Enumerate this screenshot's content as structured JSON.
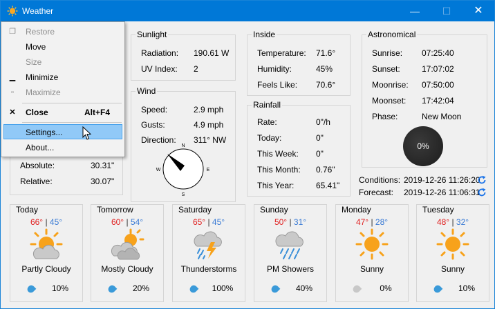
{
  "window": {
    "title": "Weather",
    "min_glyph": "—",
    "max_glyph": "☐",
    "close_glyph": "✕"
  },
  "sunlight": {
    "legend": "Sunlight",
    "radiation_label": "Radiation:",
    "radiation_value": "190.61 W",
    "uv_label": "UV Index:",
    "uv_value": "2"
  },
  "wind": {
    "legend": "Wind",
    "speed_label": "Speed:",
    "speed_value": "2.9 mph",
    "gusts_label": "Gusts:",
    "gusts_value": "4.9 mph",
    "direction_label": "Direction:",
    "direction_value": "311° NW",
    "compass": {
      "n": "N",
      "e": "E",
      "s": "S",
      "w": "W"
    }
  },
  "pressure": {
    "absolute_label": "Absolute:",
    "absolute_value": "30.31\"",
    "relative_label": "Relative:",
    "relative_value": "30.07\""
  },
  "inside": {
    "legend": "Inside",
    "temperature_label": "Temperature:",
    "temperature_value": "71.6°",
    "humidity_label": "Humidity:",
    "humidity_value": "45%",
    "feels_label": "Feels Like:",
    "feels_value": "70.6°"
  },
  "rainfall": {
    "legend": "Rainfall",
    "rate_label": "Rate:",
    "rate_value": "0\"/h",
    "today_label": "Today:",
    "today_value": "0\"",
    "week_label": "This Week:",
    "week_value": "0\"",
    "month_label": "This Month:",
    "month_value": "0.76\"",
    "year_label": "This Year:",
    "year_value": "65.41\""
  },
  "astronomical": {
    "legend": "Astronomical",
    "sunrise_label": "Sunrise:",
    "sunrise_value": "07:25:40",
    "sunset_label": "Sunset:",
    "sunset_value": "17:07:02",
    "moonrise_label": "Moonrise:",
    "moonrise_value": "07:50:00",
    "moonset_label": "Moonset:",
    "moonset_value": "17:42:04",
    "phase_label": "Phase:",
    "phase_value": "New Moon",
    "moon_pct": "0%"
  },
  "updates": {
    "conditions_label": "Conditions:",
    "conditions_value": "2019-12-26 11:26:20",
    "forecast_label": "Forecast:",
    "forecast_value": "2019-12-26 11:06:31"
  },
  "forecast": [
    {
      "day": "Today",
      "hi": "66°",
      "sep": "|",
      "lo": "45°",
      "cond": "Partly Cloudy",
      "precip": "10%",
      "icon": "partly-cloudy"
    },
    {
      "day": "Tomorrow",
      "hi": "60°",
      "sep": "|",
      "lo": "54°",
      "cond": "Mostly Cloudy",
      "precip": "20%",
      "icon": "mostly-cloudy"
    },
    {
      "day": "Saturday",
      "hi": "65°",
      "sep": "|",
      "lo": "45°",
      "cond": "Thunderstorms",
      "precip": "100%",
      "icon": "thunderstorm"
    },
    {
      "day": "Sunday",
      "hi": "50°",
      "sep": "|",
      "lo": "31°",
      "cond": "PM Showers",
      "precip": "40%",
      "icon": "showers"
    },
    {
      "day": "Monday",
      "hi": "47°",
      "sep": "|",
      "lo": "28°",
      "cond": "Sunny",
      "precip": "0%",
      "icon": "sunny"
    },
    {
      "day": "Tuesday",
      "hi": "48°",
      "sep": "|",
      "lo": "32°",
      "cond": "Sunny",
      "precip": "10%",
      "icon": "sunny"
    }
  ],
  "menu": {
    "restore": "Restore",
    "move": "Move",
    "size": "Size",
    "minimize": "Minimize",
    "maximize": "Maximize",
    "close": "Close",
    "close_key": "Alt+F4",
    "settings": "Settings...",
    "about": "About..."
  },
  "colors": {
    "titlebar": "#0078d7",
    "high_temp": "#e02020",
    "low_temp": "#3a7bd5",
    "menu_highlight": "#91c9f7"
  }
}
